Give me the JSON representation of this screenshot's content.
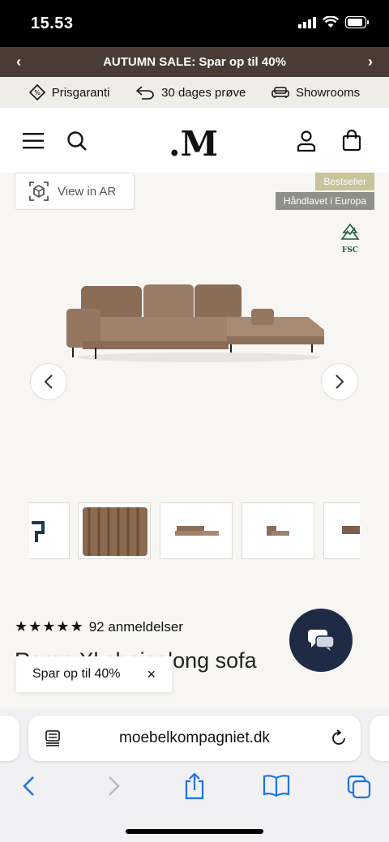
{
  "status_bar": {
    "time": "15.53"
  },
  "promo": {
    "text": "AUTUMN SALE: Spar op til 40%"
  },
  "usps": [
    {
      "icon": "price-tag-icon",
      "label": "Prisgaranti"
    },
    {
      "icon": "return-arrow-icon",
      "label": "30 dages prøve"
    },
    {
      "icon": "sofa-icon",
      "label": "Showrooms"
    }
  ],
  "header": {
    "logo": ".M"
  },
  "gallery": {
    "ar_label": "View in AR",
    "badges": [
      "Bestseller",
      "Håndlavet i Europa"
    ],
    "fsc_label": "FSC"
  },
  "colors": {
    "promo_bg": "#4a3c34",
    "sofa": "#9a7b63",
    "chat_bg": "#1f2a44",
    "link_blue": "#1a73e8"
  },
  "reviews": {
    "stars": 5,
    "label": "92 anmeldelser"
  },
  "product": {
    "title": "Rome Xl chaiselong sofa"
  },
  "toast": {
    "text": "Spar op til 40%",
    "close": "×"
  },
  "browser": {
    "url": "moebelkompagniet.dk"
  }
}
